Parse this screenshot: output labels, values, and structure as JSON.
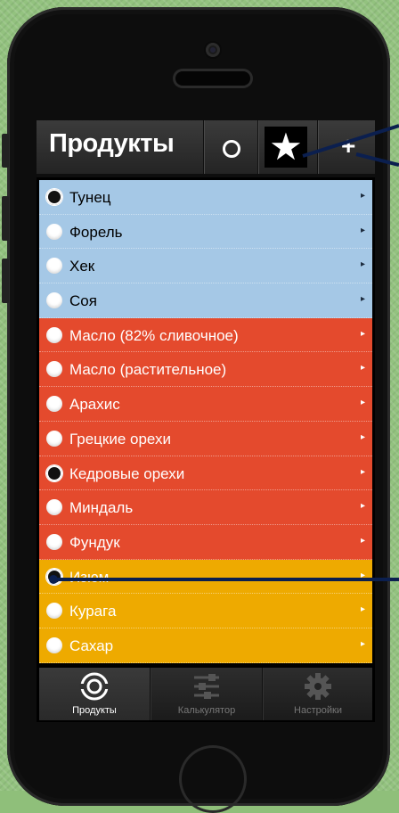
{
  "header": {
    "title": "Продукты",
    "circle_icon": "circle-outline-icon",
    "star_icon": "star-icon",
    "plus_icon": "plus-icon",
    "plus_glyph": "+"
  },
  "products": [
    {
      "name": "Тунец",
      "checked": true,
      "group": "blue"
    },
    {
      "name": "Форель",
      "checked": false,
      "group": "blue"
    },
    {
      "name": "Хек",
      "checked": false,
      "group": "blue"
    },
    {
      "name": "Соя",
      "checked": false,
      "group": "blue"
    },
    {
      "name": "Масло (82% сливочное)",
      "checked": false,
      "group": "red"
    },
    {
      "name": "Масло (растительное)",
      "checked": false,
      "group": "red"
    },
    {
      "name": "Арахис",
      "checked": false,
      "group": "red"
    },
    {
      "name": "Грецкие орехи",
      "checked": false,
      "group": "red"
    },
    {
      "name": "Кедровые орехи",
      "checked": true,
      "group": "red"
    },
    {
      "name": "Миндаль",
      "checked": false,
      "group": "red"
    },
    {
      "name": "Фундук",
      "checked": false,
      "group": "red"
    },
    {
      "name": "Изюм",
      "checked": true,
      "group": "yellow"
    },
    {
      "name": "Курага",
      "checked": false,
      "group": "yellow"
    },
    {
      "name": "Сахар",
      "checked": false,
      "group": "yellow"
    }
  ],
  "tabs": [
    {
      "label": "Продукты",
      "icon": "products-icon",
      "active": true
    },
    {
      "label": "Калькулятор",
      "icon": "sliders-icon",
      "active": false
    },
    {
      "label": "Настройки",
      "icon": "gear-icon",
      "active": false
    }
  ],
  "colors": {
    "blue_group": "#a5c8e6",
    "red_group": "#e44a2d",
    "yellow_group": "#eeaa00",
    "annotation_line": "#0b1f4f"
  }
}
